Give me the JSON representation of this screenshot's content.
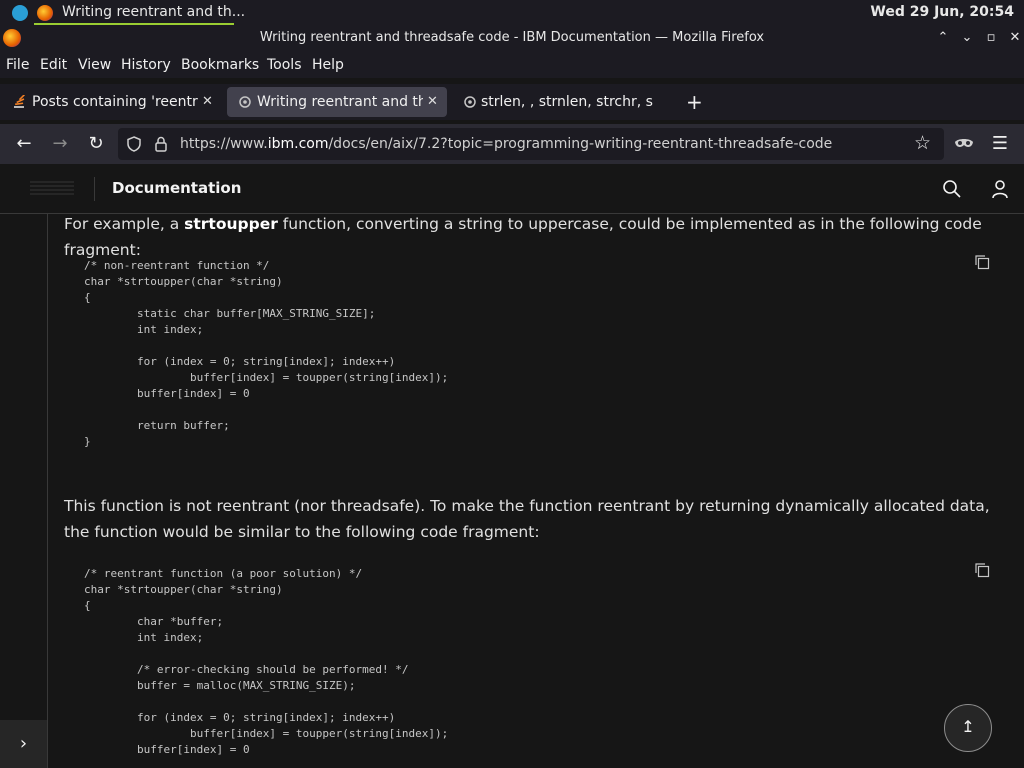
{
  "taskbar": {
    "window_label": "Writing reentrant and th...",
    "clock": "Wed 29 Jun, 20:54"
  },
  "window": {
    "title": "Writing reentrant and threadsafe code - IBM Documentation — Mozilla Firefox"
  },
  "menu": [
    "File",
    "Edit",
    "View",
    "History",
    "Bookmarks",
    "Tools",
    "Help"
  ],
  "tabs": [
    {
      "label": "Posts containing 'reentrant",
      "active": false
    },
    {
      "label": "Writing reentrant and thr",
      "active": true
    },
    {
      "label": "strlen, , strnlen, strchr, st",
      "active": false
    }
  ],
  "urlbar": {
    "prefix": "https://www.",
    "domain": "ibm.com",
    "path": "/docs/en/aix/7.2?topic=programming-writing-reentrant-threadsafe-code"
  },
  "header": {
    "title": "Documentation"
  },
  "content": {
    "para1_before": "For example, a ",
    "para1_bold": "strtoupper",
    "para1_after": " function, converting a string to uppercase, could be implemented as in the following code fragment:",
    "code1": "/* non-reentrant function */\nchar *strtoupper(char *string)\n{\n        static char buffer[MAX_STRING_SIZE];\n        int index;\n\n        for (index = 0; string[index]; index++)\n                buffer[index] = toupper(string[index]);\n        buffer[index] = 0\n\n        return buffer;\n}",
    "para2": "This function is not reentrant (nor threadsafe). To make the function reentrant by returning dynamically allocated data, the function would be similar to the following code fragment:",
    "code2": "/* reentrant function (a poor solution) */\nchar *strtoupper(char *string)\n{\n        char *buffer;\n        int index;\n\n        /* error-checking should be performed! */\n        buffer = malloc(MAX_STRING_SIZE);\n\n        for (index = 0; string[index]; index++)\n                buffer[index] = toupper(string[index]);\n        buffer[index] = 0"
  },
  "icons": {
    "copy": "copy-icon",
    "search": "search-icon",
    "user": "user-icon",
    "back_to_top": "back-to-top-icon",
    "expand": "chevron-right-icon"
  }
}
